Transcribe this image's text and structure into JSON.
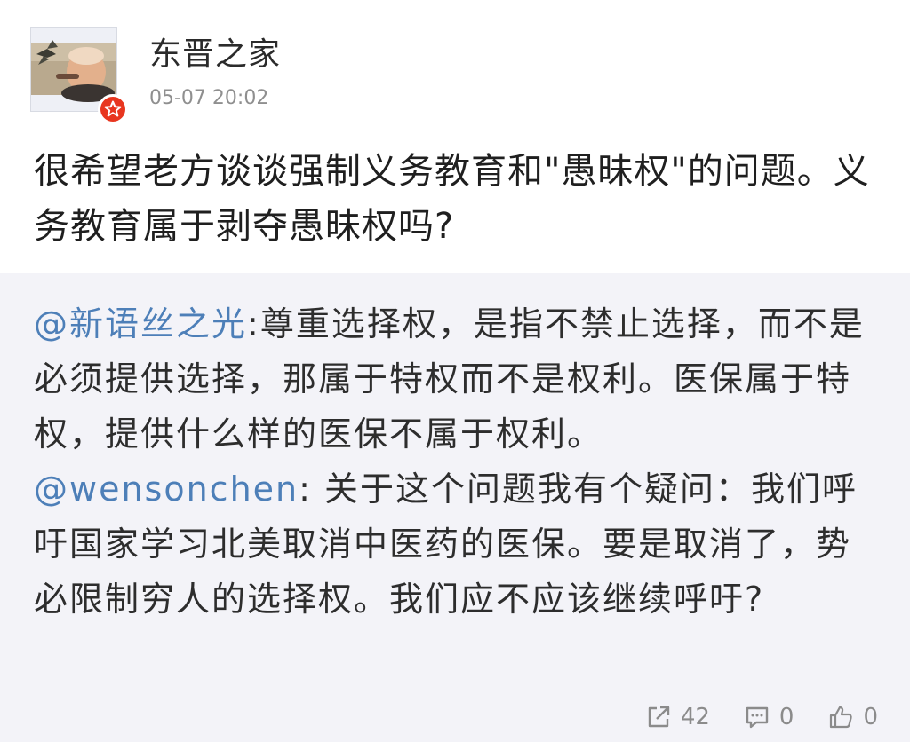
{
  "post": {
    "author": "东晋之家",
    "timestamp": "05-07 20:02",
    "text": "很希望老方谈谈强制义务教育和\"愚昧权\"的问题。义务教育属于剥夺愚昧权吗?"
  },
  "repost": {
    "mention1": "@新语丝之光",
    "text1": ":尊重选择权，是指不禁止选择，而不是必须提供选择，那属于特权而不是权利。医保属于特权，提供什么样的医保不属于权利。",
    "mention2": "@wensonchen",
    "text2": ": 关于这个问题我有个疑问：我们呼吁国家学习北美取消中医药的医保。要是取消了，势必限制穷人的选择权。我们应不应该继续呼吁?"
  },
  "actions": {
    "repost_count": "42",
    "comment_count": "0",
    "like_count": "0"
  },
  "colors": {
    "mention": "#4d7fb8",
    "badge": "#e8361f",
    "quote_background": "#f3f3f8"
  },
  "icons": [
    "verified-star-icon",
    "share-icon",
    "comment-icon",
    "like-icon"
  ]
}
